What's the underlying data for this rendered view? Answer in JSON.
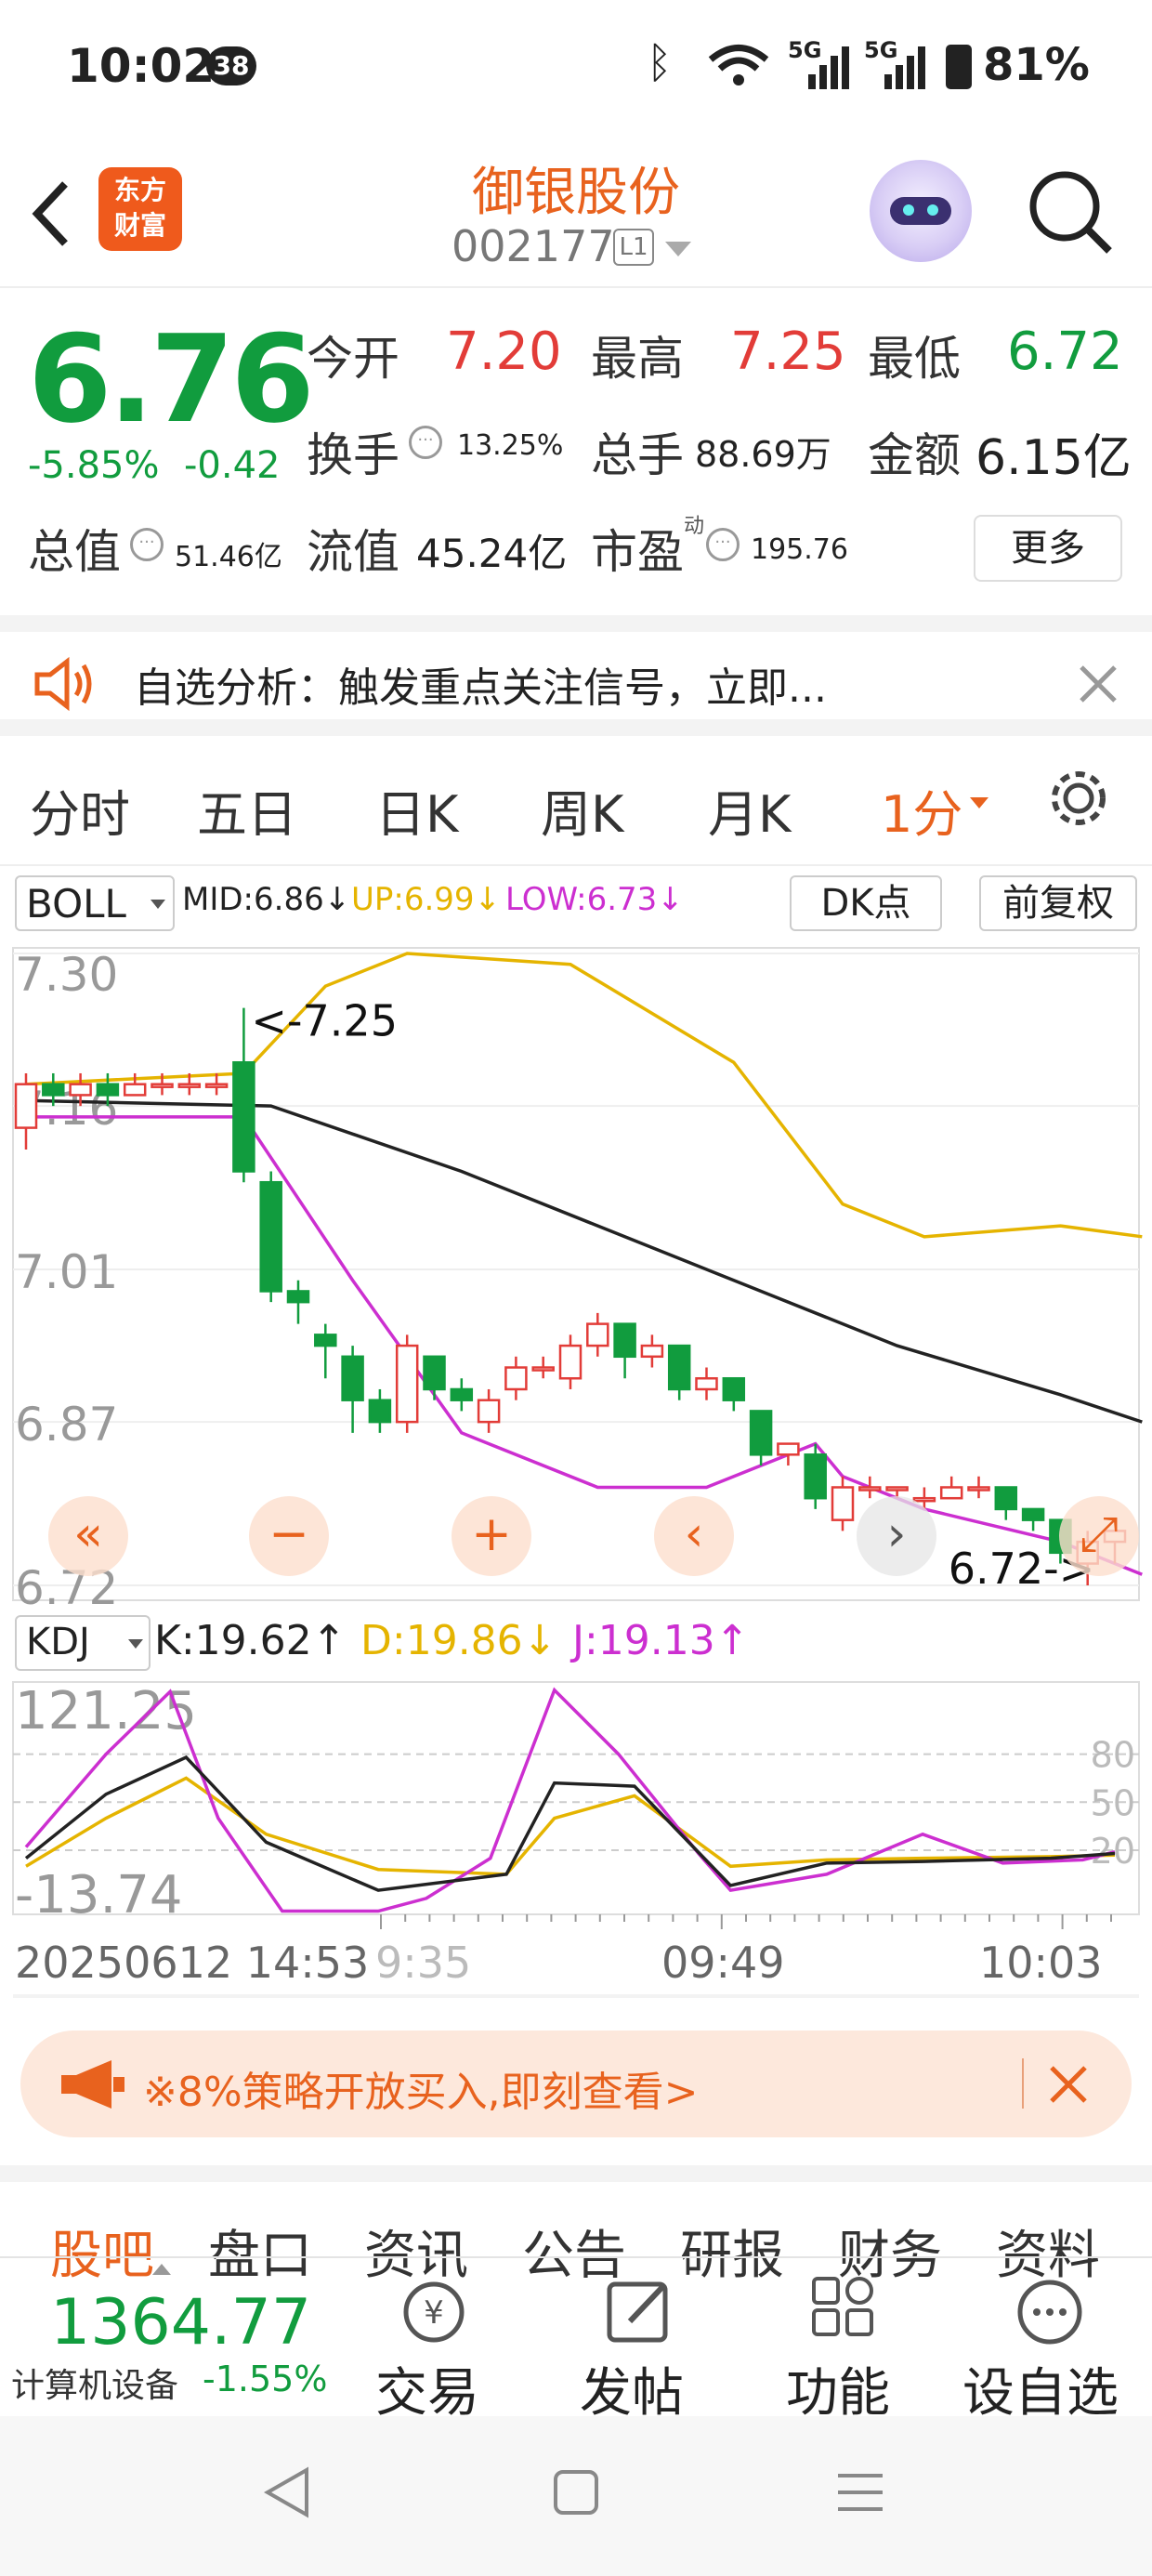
{
  "status": {
    "time": "10:02",
    "notif": "38",
    "net1": "5G",
    "net2": "5G",
    "battery": "81%"
  },
  "header": {
    "app_logo": "东方\n财富",
    "title": "御银股份",
    "code": "002177",
    "level": "L1"
  },
  "quote": {
    "price": "6.76",
    "pct": "-5.85%",
    "chg": "-0.42",
    "rows": [
      [
        {
          "l": "今开",
          "v": "7.20",
          "c": "red"
        },
        {
          "l": "最高",
          "v": "7.25",
          "c": "red"
        },
        {
          "l": "最低",
          "v": "6.72",
          "c": "green"
        }
      ],
      [
        {
          "l": "换手",
          "v": "13.25%",
          "c": "dark",
          "s": true
        },
        {
          "l": "总手",
          "v": "88.69万",
          "c": "dark"
        },
        {
          "l": "金额",
          "v": "6.15亿",
          "c": "dark"
        }
      ]
    ],
    "row3": [
      {
        "l": "总值",
        "v": "51.46亿",
        "s": true
      },
      {
        "l": "流值",
        "v": "45.24亿"
      },
      {
        "l": "市盈",
        "sup": "动",
        "v": "195.76",
        "s": true
      }
    ],
    "more": "更多"
  },
  "banner": {
    "text": "自选分析：触发重点关注信号，立即..."
  },
  "tabs": [
    "分时",
    "五日",
    "日K",
    "周K",
    "月K",
    "1分"
  ],
  "indicator": {
    "name": "BOLL",
    "mid": "MID:6.86↓",
    "up": "UP:6.99↓",
    "low": "LOW:6.73↓",
    "dk": "DK点",
    "adj": "前复权"
  },
  "chart_data": {
    "type": "candlestick",
    "title": "",
    "y_ticks": [
      "7.30",
      "7.16",
      "7.01",
      "6.87",
      "6.72"
    ],
    "ylim": [
      6.72,
      7.3
    ],
    "high_label": "<-7.25",
    "low_label": "6.72->",
    "candles": [
      [
        7.14,
        7.18,
        7.19,
        7.12
      ],
      [
        7.18,
        7.17,
        7.19,
        7.16
      ],
      [
        7.17,
        7.18,
        7.19,
        7.16
      ],
      [
        7.18,
        7.17,
        7.19,
        7.16
      ],
      [
        7.17,
        7.18,
        7.19,
        7.17
      ],
      [
        7.18,
        7.18,
        7.19,
        7.17
      ],
      [
        7.18,
        7.18,
        7.19,
        7.17
      ],
      [
        7.18,
        7.18,
        7.19,
        7.17
      ],
      [
        7.2,
        7.1,
        7.25,
        7.09
      ],
      [
        7.09,
        6.99,
        7.1,
        6.98
      ],
      [
        6.99,
        6.98,
        7.0,
        6.96
      ],
      [
        6.95,
        6.94,
        6.96,
        6.91
      ],
      [
        6.93,
        6.89,
        6.94,
        6.86
      ],
      [
        6.89,
        6.87,
        6.9,
        6.86
      ],
      [
        6.87,
        6.94,
        6.95,
        6.86
      ],
      [
        6.93,
        6.9,
        6.93,
        6.89
      ],
      [
        6.9,
        6.89,
        6.91,
        6.88
      ],
      [
        6.87,
        6.89,
        6.9,
        6.86
      ],
      [
        6.9,
        6.92,
        6.93,
        6.89
      ],
      [
        6.92,
        6.92,
        6.93,
        6.91
      ],
      [
        6.91,
        6.94,
        6.95,
        6.9
      ],
      [
        6.94,
        6.96,
        6.97,
        6.93
      ],
      [
        6.96,
        6.93,
        6.96,
        6.91
      ],
      [
        6.93,
        6.94,
        6.95,
        6.92
      ],
      [
        6.94,
        6.9,
        6.94,
        6.89
      ],
      [
        6.9,
        6.91,
        6.92,
        6.89
      ],
      [
        6.91,
        6.89,
        6.91,
        6.88
      ],
      [
        6.88,
        6.84,
        6.88,
        6.83
      ],
      [
        6.84,
        6.85,
        6.85,
        6.83
      ],
      [
        6.84,
        6.8,
        6.85,
        6.79
      ],
      [
        6.78,
        6.81,
        6.82,
        6.77
      ],
      [
        6.81,
        6.81,
        6.82,
        6.8
      ],
      [
        6.81,
        6.81,
        6.81,
        6.8
      ],
      [
        6.8,
        6.8,
        6.81,
        6.79
      ],
      [
        6.8,
        6.81,
        6.82,
        6.8
      ],
      [
        6.81,
        6.81,
        6.82,
        6.8
      ],
      [
        6.81,
        6.79,
        6.81,
        6.78
      ],
      [
        6.79,
        6.78,
        6.79,
        6.77
      ],
      [
        6.78,
        6.75,
        6.78,
        6.74
      ],
      [
        6.74,
        6.76,
        6.77,
        6.72
      ],
      [
        6.76,
        6.77,
        6.77,
        6.74
      ]
    ],
    "mid": [
      [
        0,
        7.165
      ],
      [
        9,
        7.16
      ],
      [
        16,
        7.1
      ],
      [
        24,
        7.02
      ],
      [
        32,
        6.94
      ],
      [
        38,
        6.895
      ],
      [
        41,
        6.87
      ]
    ],
    "upper": [
      [
        0,
        7.18
      ],
      [
        8,
        7.19
      ],
      [
        11,
        7.27
      ],
      [
        14,
        7.3
      ],
      [
        20,
        7.29
      ],
      [
        26,
        7.2
      ],
      [
        30,
        7.07
      ],
      [
        33,
        7.04
      ],
      [
        38,
        7.05
      ],
      [
        41,
        7.04
      ]
    ],
    "lower": [
      [
        0,
        7.15
      ],
      [
        8,
        7.15
      ],
      [
        12,
        7.0
      ],
      [
        16,
        6.86
      ],
      [
        21,
        6.81
      ],
      [
        25,
        6.81
      ],
      [
        29,
        6.85
      ],
      [
        30,
        6.82
      ],
      [
        33,
        6.79
      ],
      [
        38,
        6.76
      ],
      [
        41,
        6.73
      ]
    ],
    "kdj": {
      "k": "K:19.62↑",
      "d": "D:19.86↓",
      "j": "J:19.13↑",
      "y_top": "121.25",
      "y_bot": "-13.74",
      "levels": [
        "80",
        "50",
        "20"
      ],
      "K": [
        [
          0,
          15
        ],
        [
          5,
          55
        ],
        [
          10,
          78
        ],
        [
          15,
          25
        ],
        [
          22,
          -5
        ],
        [
          30,
          5
        ],
        [
          33,
          62
        ],
        [
          38,
          60
        ],
        [
          44,
          -2
        ],
        [
          50,
          12
        ],
        [
          56,
          13
        ],
        [
          64,
          15
        ],
        [
          68,
          18
        ]
      ],
      "D": [
        [
          0,
          10
        ],
        [
          5,
          40
        ],
        [
          10,
          65
        ],
        [
          15,
          30
        ],
        [
          22,
          8
        ],
        [
          30,
          5
        ],
        [
          33,
          40
        ],
        [
          38,
          54
        ],
        [
          44,
          10
        ],
        [
          50,
          14
        ],
        [
          56,
          15
        ],
        [
          64,
          16
        ],
        [
          68,
          17
        ]
      ],
      "J": [
        [
          0,
          22
        ],
        [
          5,
          80
        ],
        [
          9,
          119
        ],
        [
          12,
          40
        ],
        [
          16,
          -18
        ],
        [
          22,
          -18
        ],
        [
          25,
          -10
        ],
        [
          29,
          15
        ],
        [
          33,
          120
        ],
        [
          37,
          80
        ],
        [
          42,
          18
        ],
        [
          44,
          -5
        ],
        [
          50,
          5
        ],
        [
          56,
          30
        ],
        [
          61,
          12
        ],
        [
          66,
          14
        ],
        [
          68,
          19
        ]
      ]
    },
    "x_labels": [
      "20250612 14:53",
      "9:35",
      "09:49",
      "10:03"
    ]
  },
  "promo": {
    "text": "※8%策略开放买入,即刻查看>"
  },
  "subtabs": [
    "股吧",
    "盘口",
    "资讯",
    "公告",
    "研报",
    "财务",
    "资料"
  ],
  "bottom": {
    "index_val": "1364.77",
    "sector": "计算机设备",
    "sector_pct": "-1.55%",
    "buttons": [
      "交易",
      "发帖",
      "功能",
      "设自选"
    ]
  }
}
